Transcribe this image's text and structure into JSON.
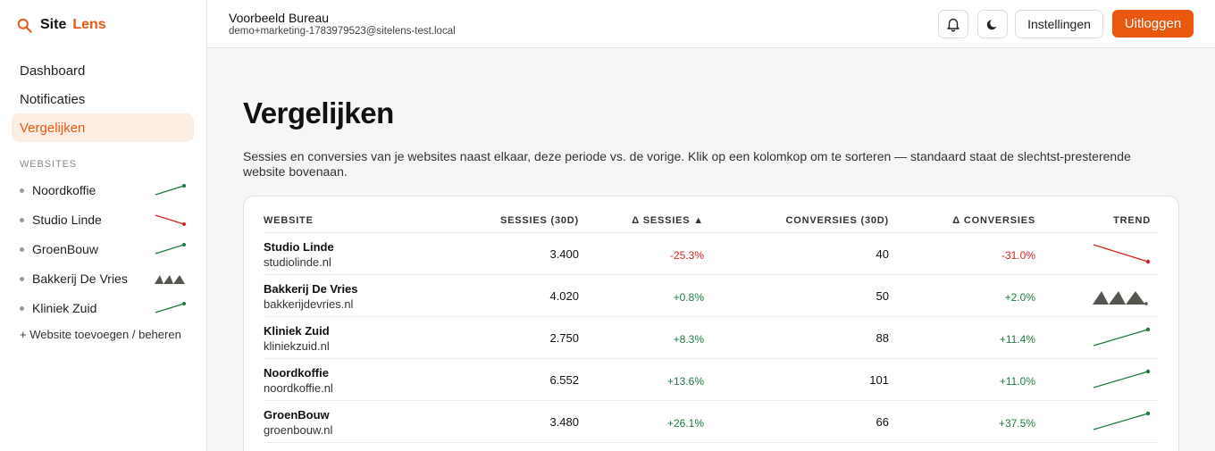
{
  "brand": {
    "word1": "Site",
    "word2": "Lens",
    "accent": "#e8580f"
  },
  "nav": [
    {
      "label": "Dashboard",
      "active": false
    },
    {
      "label": "Notificaties",
      "active": false
    },
    {
      "label": "Vergelijken",
      "active": true
    }
  ],
  "sidebar": {
    "section_label": "WEBSITES",
    "sites": [
      {
        "name": "Noordkoffie",
        "spark": "up"
      },
      {
        "name": "Studio Linde",
        "spark": "down"
      },
      {
        "name": "GroenBouw",
        "spark": "up"
      },
      {
        "name": "Bakkerij De Vries",
        "spark": "peaks"
      },
      {
        "name": "Kliniek Zuid",
        "spark": "up"
      }
    ],
    "add_link": "+ Website toevoegen / beheren"
  },
  "topbar": {
    "org_name": "Voorbeeld Bureau",
    "email": "demo+marketing-1783979523@sitelens-test.local",
    "icons": [
      "bell-icon",
      "moon-icon"
    ],
    "settings_label": "Instellingen",
    "logout_label": "Uitloggen"
  },
  "page": {
    "title": "Vergelijken",
    "description": "Sessies en conversies van je websites naast elkaar, deze periode vs. de vorige. Klik op een kolomkop om te sorteren — standaard staat de slechtst-presterende website bovenaan."
  },
  "table": {
    "headers": {
      "website": "WEBSITE",
      "sessions": "SESSIES (30D)",
      "delta_sessions": "Δ SESSIES ▲",
      "conversions": "CONVERSIES (30D)",
      "delta_conversions": "Δ CONVERSIES",
      "trend": "TREND"
    },
    "rows": [
      {
        "name": "Studio Linde",
        "domain": "studiolinde.nl",
        "sessions": "3.400",
        "delta_sessions": "-25.3%",
        "conversions": "40",
        "delta_conversions": "-31.0%",
        "trend": "down",
        "negative": true
      },
      {
        "name": "Bakkerij De Vries",
        "domain": "bakkerijdevries.nl",
        "sessions": "4.020",
        "delta_sessions": "+0.8%",
        "conversions": "50",
        "delta_conversions": "+2.0%",
        "trend": "peaks",
        "negative": false
      },
      {
        "name": "Kliniek Zuid",
        "domain": "kliniekzuid.nl",
        "sessions": "2.750",
        "delta_sessions": "+8.3%",
        "conversions": "88",
        "delta_conversions": "+11.4%",
        "trend": "up",
        "negative": false
      },
      {
        "name": "Noordkoffie",
        "domain": "noordkoffie.nl",
        "sessions": "6.552",
        "delta_sessions": "+13.6%",
        "conversions": "101",
        "delta_conversions": "+11.0%",
        "trend": "up",
        "negative": false
      },
      {
        "name": "GroenBouw",
        "domain": "groenbouw.nl",
        "sessions": "3.480",
        "delta_sessions": "+26.1%",
        "conversions": "66",
        "delta_conversions": "+37.5%",
        "trend": "up",
        "negative": false
      }
    ]
  },
  "colors": {
    "positive": "#1c7a3e",
    "negative": "#d62020",
    "peaks": "#555550"
  }
}
